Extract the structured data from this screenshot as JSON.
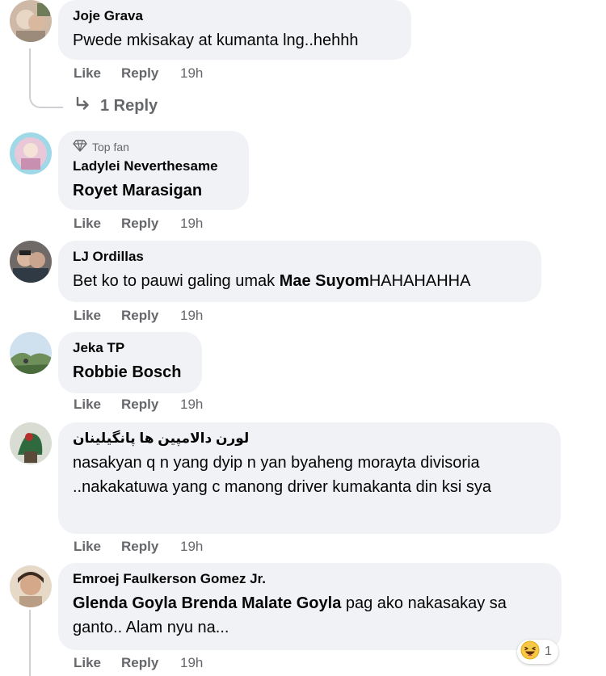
{
  "colors": {
    "bubble": "#f0f2f5",
    "secondary_text": "#65676b",
    "primary_text": "#050505",
    "thread_line": "#ced0d4"
  },
  "comments": [
    {
      "author": "Joje Grava",
      "text": "Pwede mkisakay at kumanta lng..hehhh",
      "actions": {
        "like": "Like",
        "reply": "Reply",
        "time": "19h"
      },
      "replies": {
        "icon": "reply-arrow-icon",
        "label": "1 Reply"
      }
    },
    {
      "badge": {
        "icon": "diamond-icon",
        "label": "Top fan"
      },
      "author": "Ladylei Neverthesame",
      "tag": "Royet Marasigan",
      "actions": {
        "like": "Like",
        "reply": "Reply",
        "time": "19h"
      }
    },
    {
      "author": "LJ Ordillas",
      "text_before": "Bet ko to pauwi galing umak ",
      "tag": "Mae Suyom",
      "text_after": "HAHAHAHHA",
      "actions": {
        "like": "Like",
        "reply": "Reply",
        "time": "19h"
      }
    },
    {
      "author": "Jeka TP",
      "tag": "Robbie Bosch",
      "actions": {
        "like": "Like",
        "reply": "Reply",
        "time": "19h"
      }
    },
    {
      "author": "لورن دالامپین ها پانگیلینان",
      "text": "nasakyan q n yang dyip n yan byaheng morayta divisoria ..nakakatuwa yang c manong driver kumakanta din ksi sya",
      "actions": {
        "like": "Like",
        "reply": "Reply",
        "time": "19h"
      }
    },
    {
      "author": "Emroej Faulkerson Gomez Jr.",
      "tag": "Glenda Goyla Brenda Malate Goyla",
      "text_after": " pag ako nakasakay sa ganto.. Alam nyu na...",
      "actions": {
        "like": "Like",
        "reply": "Reply",
        "time": "19h"
      },
      "reaction": {
        "icon": "haha-emoji-icon",
        "count": "1"
      }
    }
  ]
}
